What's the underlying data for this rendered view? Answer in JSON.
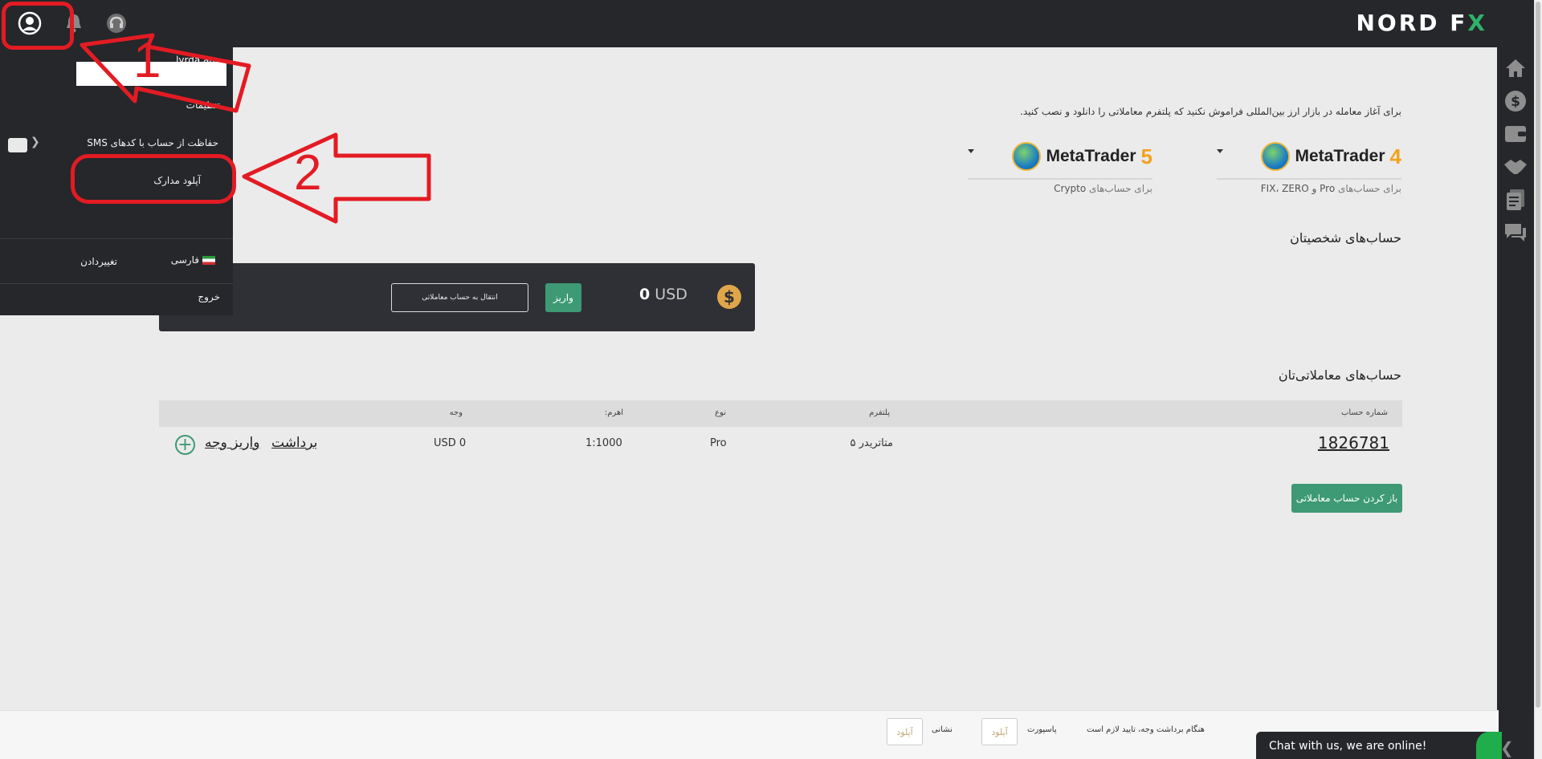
{
  "brand": {
    "logo_main": "NORD F",
    "logo_x": "X",
    "accent": "#3d9a75",
    "brand_green": "#2fb26a",
    "annotation_red": "#e31b23"
  },
  "topbar": {
    "icons": [
      "user-icon",
      "bell-icon",
      "support-headset-icon"
    ]
  },
  "menu": {
    "username": "lyrda au",
    "items": {
      "settings": "تنظیمات",
      "sms_protect": "حفاظت از حساب با کدهای SMS",
      "upload_docs": "آپلود مدارک",
      "language": "فارسی",
      "change": "تغییردادن",
      "logout": "خروج"
    }
  },
  "annotations": {
    "one": "1",
    "two": "2"
  },
  "main": {
    "intro": "برای آغاز معامله در بازار ارز بین‌المللی فراموش نکنید که پلتفرم معاملاتی را دانلود و نصب کنید.",
    "platforms": [
      {
        "name": "MetaTrader",
        "version": "4",
        "sub_prefix": "برای حساب‌های",
        "sub_accounts": "Pro و FIX، ZERO"
      },
      {
        "name": "MetaTrader",
        "version": "5",
        "sub_prefix": "برای حساب‌های",
        "sub_accounts": "Crypto"
      }
    ],
    "personal_title": "حساب‌های شخصیتان",
    "wallet": {
      "amount": "0",
      "currency": "USD",
      "deposit": "واریز",
      "transfer": "انتقال به حساب معاملاتی"
    },
    "trading_title": "حساب‌های معاملاتی‌تان",
    "table": {
      "headers": {
        "account": "شماره حساب",
        "platform": "پلتفرم",
        "type": "نوع",
        "leverage": "اهرم:",
        "funds": "وجه"
      },
      "row": {
        "account": "1826781",
        "platform": "متاتریدر ۵",
        "type": "Pro",
        "leverage": "1:1000",
        "funds": "0 USD",
        "withdraw": "برداشت",
        "deposit": "واریز وجه"
      }
    },
    "open_account": "باز کردن حساب معاملاتی"
  },
  "footer": {
    "note": "هنگام برداشت وجه، تایید لازم است",
    "passport": "پاسپورت",
    "address": "نشانی",
    "upload": "آپلود",
    "chat": "Chat with us, we are online!"
  }
}
